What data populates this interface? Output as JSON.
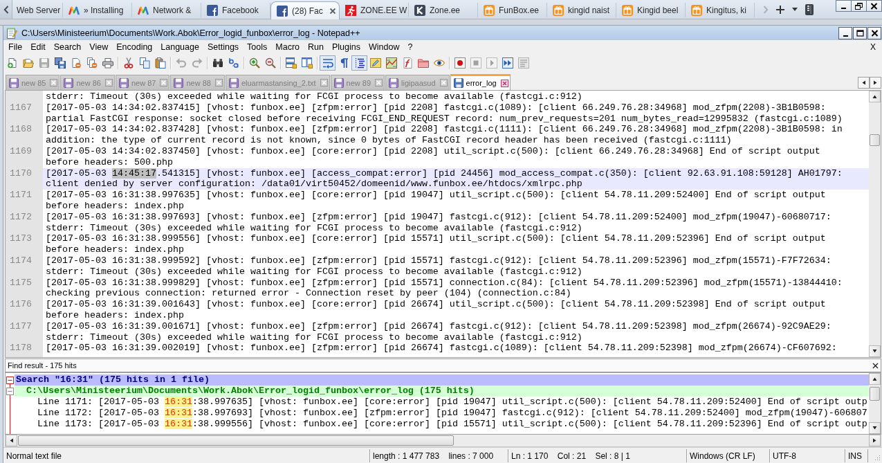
{
  "browser": {
    "tabs": [
      {
        "title": "Web Server",
        "kind": "blank",
        "selected": false
      },
      {
        "title": "» Installing",
        "kind": "mlogo",
        "selected": false
      },
      {
        "title": "Network &",
        "kind": "mlogo",
        "selected": false
      },
      {
        "title": "Facebook",
        "kind": "flogo",
        "selected": false
      },
      {
        "title": "(28) Fac",
        "kind": "flogo",
        "selected": true
      },
      {
        "title": "ZONE.EE W",
        "kind": "runner",
        "selected": false
      },
      {
        "title": "Zone.ee",
        "kind": "klogo",
        "selected": false
      },
      {
        "title": "FunBox.ee",
        "kind": "gift",
        "selected": false
      },
      {
        "title": "kingid naist",
        "kind": "gift",
        "selected": false
      },
      {
        "title": "Kingid beel",
        "kind": "gift",
        "selected": false
      },
      {
        "title": "Kingitus, ki",
        "kind": "gift",
        "selected": false
      }
    ]
  },
  "notepad": {
    "title": "C:\\Users\\Ministeerium\\Documents\\Work.Abok\\Error_logid_funbox\\error_log - Notepad++",
    "menu": {
      "items": [
        "File",
        "Edit",
        "Search",
        "View",
        "Encoding",
        "Language",
        "Settings",
        "Tools",
        "Macro",
        "Run",
        "Plugins",
        "Window",
        "?"
      ],
      "close": "X"
    },
    "toolbar": [
      [
        {
          "kind": "new",
          "on": false,
          "disabled": false
        },
        {
          "kind": "open",
          "on": false,
          "disabled": false
        },
        {
          "kind": "save",
          "on": false,
          "disabled": true
        },
        {
          "kind": "saveall",
          "on": false,
          "disabled": false
        },
        {
          "kind": "close",
          "on": false,
          "disabled": false
        },
        {
          "kind": "closeall",
          "on": false,
          "disabled": false
        },
        {
          "kind": "print",
          "on": false,
          "disabled": false
        }
      ],
      [
        {
          "kind": "cut",
          "on": false,
          "disabled": false
        },
        {
          "kind": "copy",
          "on": false,
          "disabled": false
        },
        {
          "kind": "paste",
          "on": false,
          "disabled": false
        }
      ],
      [
        {
          "kind": "undo",
          "on": false,
          "disabled": true
        },
        {
          "kind": "redo",
          "on": false,
          "disabled": true
        }
      ],
      [
        {
          "kind": "find",
          "on": false,
          "disabled": false
        },
        {
          "kind": "replace",
          "on": false,
          "disabled": false
        }
      ],
      [
        {
          "kind": "zoomin",
          "on": false,
          "disabled": false
        },
        {
          "kind": "zoomout",
          "on": false,
          "disabled": false
        }
      ],
      [
        {
          "kind": "syncv",
          "on": false,
          "disabled": false
        },
        {
          "kind": "synch",
          "on": false,
          "disabled": false
        }
      ],
      [
        {
          "kind": "wrap",
          "on": true,
          "disabled": false
        },
        {
          "kind": "allchars",
          "on": false,
          "disabled": false
        },
        {
          "kind": "indent",
          "on": true,
          "disabled": false
        },
        {
          "kind": "udl",
          "on": false,
          "disabled": false
        },
        {
          "kind": "docmap",
          "on": false,
          "disabled": false
        },
        {
          "kind": "funclist",
          "on": false,
          "disabled": false
        },
        {
          "kind": "folder",
          "on": false,
          "disabled": false
        },
        {
          "kind": "monitor",
          "on": false,
          "disabled": false
        }
      ],
      [
        {
          "kind": "record",
          "on": false,
          "disabled": false
        },
        {
          "kind": "stop",
          "on": false,
          "disabled": true
        },
        {
          "kind": "play",
          "on": false,
          "disabled": true
        },
        {
          "kind": "playmulti",
          "on": false,
          "disabled": false
        },
        {
          "kind": "savemacro",
          "on": false,
          "disabled": true
        }
      ]
    ],
    "tabs": [
      {
        "title": "new 85",
        "selected": false
      },
      {
        "title": "new 86",
        "selected": false
      },
      {
        "title": "new 87",
        "selected": false
      },
      {
        "title": "new 88",
        "selected": false
      },
      {
        "title": "eluarmastansing_2.txt",
        "selected": false
      },
      {
        "title": "new 89",
        "selected": false
      },
      {
        "title": "ligipaasud",
        "selected": false
      },
      {
        "title": "error_log",
        "selected": true
      }
    ],
    "editor": {
      "lines": [
        {
          "current": false,
          "rows": [
            "stderr: Timeout (30s) exceeded while waiting for FCGI process to become available (fastcgi.c:912)"
          ]
        },
        {
          "number": "1167",
          "current": false,
          "rows": [
            "[2017-05-03 14:34:02.837415] [vhost: funbox.ee] [zfpm:error] [pid 2208] fastcgi.c(1089): [client 66.249.76.28:34968] mod_zfpm(2208)-3B1B0598:",
            "partial FastCGI response: socket closed before receiving FCGI_END_REQUEST record: num_prev_requests=201 num_bytes_read=12995832 (fastcgi.c:1089)"
          ]
        },
        {
          "number": "1168",
          "current": false,
          "rows": [
            "[2017-05-03 14:34:02.837428] [vhost: funbox.ee] [zfpm:error] [pid 2208] fastcgi.c(1111): [client 66.249.76.28:34968] mod_zfpm(2208)-3B1B0598: in",
            "addition: the type of current record is not known, since 0 bytes of FastCGI record header has been received (fastcgi.c:1111)"
          ]
        },
        {
          "number": "1169",
          "current": false,
          "rows": [
            "[2017-05-03 14:34:02.837450] [vhost: funbox.ee] [core:error] [pid 2208] util_script.c(500): [client 66.249.76.28:34968] End of script output",
            "before headers: 500.php"
          ]
        },
        {
          "number": "1170",
          "current": true,
          "rows": [
            [
              {
                "text": "[2017-05-03 ",
                "selected": false
              },
              {
                "text": "14:45:17",
                "selected": true
              },
              {
                "text": ".541315] [vhost: funbox.ee] [access_compat:error] [pid 24456] mod_access_compat.c(350): [client 92.63.91.108:59128] AH01797:",
                "selected": false
              }
            ],
            "client denied by server configuration: /data01/virt50452/domeenid/www.funbox.ee/htdocs/xmlrpc.php"
          ]
        },
        {
          "number": "1171",
          "current": false,
          "rows": [
            "[2017-05-03 16:31:38.997635] [vhost: funbox.ee] [core:error] [pid 19047] util_script.c(500): [client 54.78.11.209:52400] End of script output",
            "before headers: index.php"
          ]
        },
        {
          "number": "1172",
          "current": false,
          "rows": [
            "[2017-05-03 16:31:38.997693] [vhost: funbox.ee] [zfpm:error] [pid 19047] fastcgi.c(912): [client 54.78.11.209:52400] mod_zfpm(19047)-60680717:",
            "stderr: Timeout (30s) exceeded while waiting for FCGI process to become available (fastcgi.c:912)"
          ]
        },
        {
          "number": "1173",
          "current": false,
          "rows": [
            "[2017-05-03 16:31:38.999556] [vhost: funbox.ee] [core:error] [pid 15571] util_script.c(500): [client 54.78.11.209:52396] End of script output",
            "before headers: index.php"
          ]
        },
        {
          "number": "1174",
          "current": false,
          "rows": [
            "[2017-05-03 16:31:38.999592] [vhost: funbox.ee] [zfpm:error] [pid 15571] fastcgi.c(912): [client 54.78.11.209:52396] mod_zfpm(15571)-F7F72634:",
            "stderr: Timeout (30s) exceeded while waiting for FCGI process to become available (fastcgi.c:912)"
          ]
        },
        {
          "number": "1175",
          "current": false,
          "rows": [
            "[2017-05-03 16:31:38.999829] [vhost: funbox.ee] [zfpm:error] [pid 15571] connection.c(84): [client 54.78.11.209:52396] mod_zfpm(15571)-13844410:",
            "checking previous connection: returned error - Connection reset by peer (104) (connection.c:84)"
          ]
        },
        {
          "number": "1176",
          "current": false,
          "rows": [
            "[2017-05-03 16:31:39.001643] [vhost: funbox.ee] [core:error] [pid 26674] util_script.c(500): [client 54.78.11.209:52398] End of script output",
            "before headers: index.php"
          ]
        },
        {
          "number": "1177",
          "current": false,
          "rows": [
            "[2017-05-03 16:31:39.001671] [vhost: funbox.ee] [zfpm:error] [pid 26674] fastcgi.c(912): [client 54.78.11.209:52398] mod_zfpm(26674)-92C9AE29:",
            "stderr: Timeout (30s) exceeded while waiting for FCGI process to become available (fastcgi.c:912)"
          ]
        },
        {
          "number": "1178",
          "current": false,
          "rows": [
            "[2017-05-03 16:31:39.002019] [vhost: funbox.ee] [zfpm:error] [pid 26674] fastcgi.c(1089): [client 54.78.11.209:52398] mod_zfpm(26674)-CF607692:"
          ]
        }
      ]
    },
    "find_result": {
      "title": "Find result - 175 hits",
      "expanded": true,
      "summary": "Search \"16:31\" (175 hits in 1 file)",
      "files": [
        {
          "path": "C:\\Users\\Ministeerium\\Documents\\Work.Abok\\Error_logid_funbox\\error_log (175 hits)",
          "expanded": true,
          "hits": [
            {
              "before": "Line 1171: [2017-05-03 ",
              "match": "16:31",
              "after": ":38.997635] [vhost: funbox.ee] [core:error] [pid 19047] util_script.c(500): [client 54.78.11.209:52400] End of script outp"
            },
            {
              "before": "Line 1172: [2017-05-03 ",
              "match": "16:31",
              "after": ":38.997693] [vhost: funbox.ee] [zfpm:error] [pid 19047] fastcgi.c(912): [client 54.78.11.209:52400] mod_zfpm(19047)-606807"
            },
            {
              "before": "Line 1173: [2017-05-03 ",
              "match": "16:31",
              "after": ":38.999556] [vhost: funbox.ee] [core:error] [pid 15571] util_script.c(500): [client 54.78.11.209:52396] End of script outp"
            }
          ]
        }
      ]
    },
    "status_bar": [
      "Normal text file",
      "length : 1 477 783    lines : 7 000",
      "Ln : 1 170    Col : 21    Sel : 8 | 1",
      "Windows (CR LF)",
      "UTF-8",
      "INS"
    ]
  }
}
